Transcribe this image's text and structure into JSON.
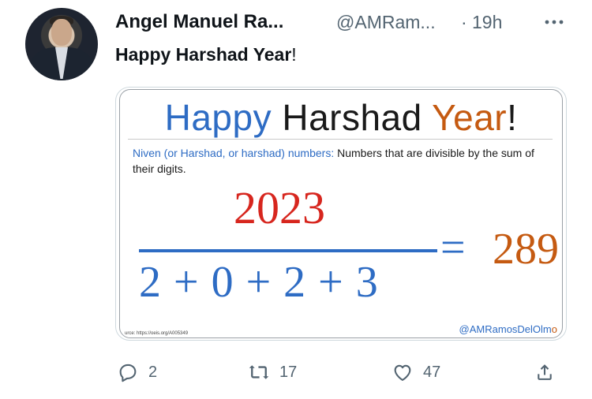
{
  "author": {
    "name": "Angel Manuel Ra...",
    "handle": "@AMRam...",
    "separator": "·",
    "time": "19h"
  },
  "tweet": {
    "text_bold": "Happy Harshad Year",
    "text_punct": "!"
  },
  "card": {
    "title_word1": "Happy",
    "title_word2": "Harshad",
    "title_word3": "Year",
    "title_excl": "!",
    "definition_term": "Niven (or Harshad, or harshad) numbers:",
    "definition_text": "Numbers that are divisible by the sum of their digits.",
    "numerator": "2023",
    "denominator": "2 + 0 + 2 + 3",
    "equals": "=",
    "result": "289",
    "source": "urce: https://oeis.org/A005349",
    "credit_main": "@AMRamosDelOlm",
    "credit_o": "o"
  },
  "actions": {
    "replies": "2",
    "retweets": "17",
    "likes": "47"
  },
  "colors": {
    "blue": "#2e6cc4",
    "red": "#d7261e",
    "orange": "#c55a11",
    "muted": "#536471"
  }
}
